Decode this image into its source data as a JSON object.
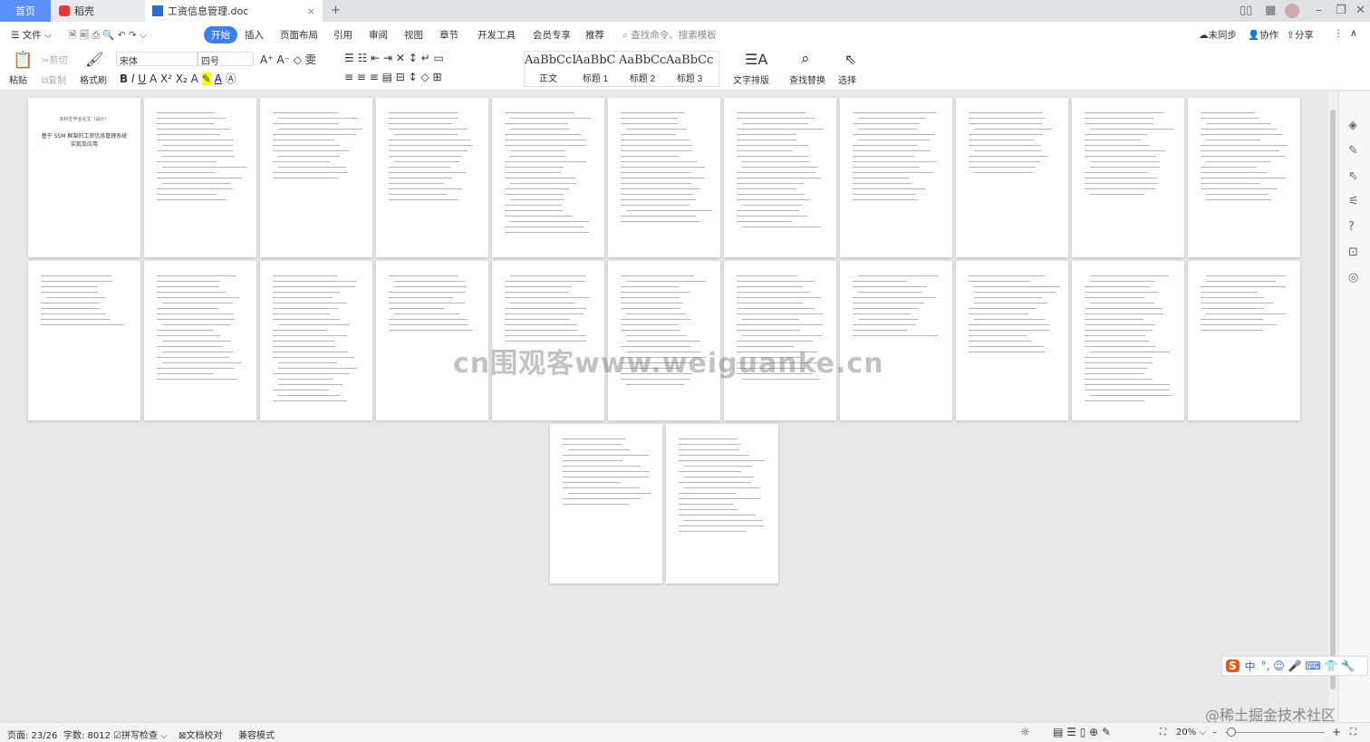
{
  "tabs": {
    "home": "首页",
    "daoke": "稻壳",
    "doc": "工资信息管理.doc",
    "new_tab": "+"
  },
  "menu": {
    "file": "文件",
    "items": [
      "开始",
      "插入",
      "页面布局",
      "引用",
      "审阅",
      "视图",
      "章节",
      "开发工具",
      "会员专享",
      "推荐"
    ],
    "search_placeholder": "查找命令、搜索模板",
    "sync": "未同步",
    "collab": "协作",
    "share": "分享"
  },
  "toolbar": {
    "paste": "粘贴",
    "cut": "剪切",
    "copy": "复制",
    "format_painter": "格式刷",
    "font": "宋体",
    "size": "四号",
    "text_layout": "文字排版",
    "find_replace": "查找替换",
    "select": "选择"
  },
  "styles": [
    {
      "sample": "AaBbCcI",
      "name": "正文"
    },
    {
      "sample": "AaBbC",
      "name": "标题 1"
    },
    {
      "sample": "AaBbCc",
      "name": "标题 2"
    },
    {
      "sample": "AaBbCc",
      "name": "标题 3"
    }
  ],
  "pages": {
    "cover_title": "本科生毕业论文（设计）",
    "cover_subtitle": "基于 SSM 框架的工资信息管理系统实现及应用",
    "watermark": "cn围观客www.weiguanke.cn"
  },
  "status": {
    "page": "页面: 23/26",
    "words": "字数: 8012",
    "spell": "拼写检查",
    "proof": "文档校对",
    "compat": "兼容模式",
    "zoom": "20%"
  },
  "ime": {
    "label": "中"
  },
  "credit": "@稀土掘金技术社区"
}
